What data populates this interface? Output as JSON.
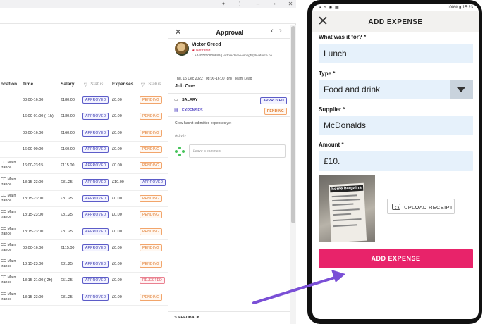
{
  "grid": {
    "columns": {
      "location": "ocation",
      "time": "Time",
      "salary": "Salary",
      "status1": "Status",
      "expenses": "Expenses",
      "status2": "Status"
    },
    "rows": [
      {
        "loc": "",
        "time": "08:00-16:00",
        "salary": "£180.00",
        "status1": "APPROVED",
        "expenses": "£0.00",
        "status2": "PENDING"
      },
      {
        "loc": "",
        "time": "16:00-01:00 (+1h)",
        "salary": "£180.00",
        "status1": "APPROVED",
        "expenses": "£0.00",
        "status2": "PENDING"
      },
      {
        "loc": "",
        "time": "08:00-16:00",
        "salary": "£160.00",
        "status1": "APPROVED",
        "expenses": "£0.00",
        "status2": "PENDING"
      },
      {
        "loc": "",
        "time": "16:00-00:00",
        "salary": "£160.00",
        "status1": "APPROVED",
        "expenses": "£0.00",
        "status2": "PENDING"
      },
      {
        "loc": "CC Main trance",
        "time": "16:00-23:15",
        "salary": "£115.00",
        "status1": "APPROVED",
        "expenses": "£0.00",
        "status2": "PENDING"
      },
      {
        "loc": "CC Main trance",
        "time": "18:15-23:00",
        "salary": "£81.25",
        "status1": "APPROVED",
        "expenses": "£10.00",
        "status2": "APPROVED"
      },
      {
        "loc": "CC Main trance",
        "time": "18:15-23:00",
        "salary": "£81.25",
        "status1": "APPROVED",
        "expenses": "£0.00",
        "status2": "PENDING"
      },
      {
        "loc": "CC Main trance",
        "time": "18:15-23:00",
        "salary": "£81.25",
        "status1": "APPROVED",
        "expenses": "£0.00",
        "status2": "PENDING"
      },
      {
        "loc": "CC Main trance",
        "time": "18:15-23:00",
        "salary": "£81.25",
        "status1": "APPROVED",
        "expenses": "£0.00",
        "status2": "PENDING"
      },
      {
        "loc": "CC Main trance",
        "time": "08:00-16:00",
        "salary": "£115.00",
        "status1": "APPROVED",
        "expenses": "£0.00",
        "status2": "PENDING"
      },
      {
        "loc": "CC Main trance",
        "time": "18:15-23:00",
        "salary": "£81.25",
        "status1": "APPROVED",
        "expenses": "£0.00",
        "status2": "PENDING"
      },
      {
        "loc": "CC Main trance",
        "time": "18:15-21:00 (-2h)",
        "salary": "£51.25",
        "status1": "APPROVED",
        "expenses": "£0.00",
        "status2": "REJECTED"
      },
      {
        "loc": "CC Main trance",
        "time": "18:15-23:00",
        "salary": "£81.25",
        "status1": "APPROVED",
        "expenses": "£0.00",
        "status2": "PENDING"
      }
    ]
  },
  "approval": {
    "title": "Approval",
    "name": "Victor Creed",
    "rating": "★ Not rated",
    "contact": "t. +4407700900889 | victor+demo-vmsgb@liveforce.co",
    "shift": "Thu, 15 Dec 2022 | 08:00-16:00 (8h) | Team Lead",
    "job": "Job One",
    "salary_label": "SALARY",
    "salary_status": "APPROVED",
    "expenses_label": "EXPENSES",
    "expenses_status": "PENDING",
    "message": "Crew hasn't submitted expenses yet",
    "activity_label": "Activity",
    "comment_placeholder": "Leave a comment",
    "feedback_label": "FEEDBACK"
  },
  "phone": {
    "status_right": "100% ▮ 15:23",
    "title": "ADD EXPENSE",
    "q1_label": "What was it for? *",
    "q1_value": "Lunch",
    "type_label": "Type *",
    "type_value": "Food and drink",
    "supplier_label": "Supplier *",
    "supplier_value": "McDonalds",
    "amount_label": "Amount *",
    "amount_value": "£10.",
    "receipt_logo": "home bargains",
    "upload_label": "UPLOAD RECEIPT",
    "submit_label": "ADD EXPENSE"
  },
  "colors": {
    "accent": "#e8236a",
    "approved": "#3b3bb0",
    "pending": "#e07a2c",
    "rejected": "#d94050",
    "arrow": "#7a4fd6"
  }
}
